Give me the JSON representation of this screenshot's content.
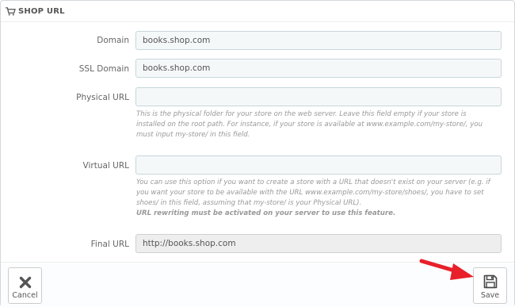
{
  "panel": {
    "title": "SHOP URL",
    "icon": "cart-icon"
  },
  "form": {
    "domain": {
      "label": "Domain",
      "value": "books.shop.com"
    },
    "ssl_domain": {
      "label": "SSL Domain",
      "value": "books.shop.com"
    },
    "physical_url": {
      "label": "Physical URL",
      "value": "",
      "help_lines": [
        "This is the physical folder for your store on the web server. Leave this field empty if your store is",
        "installed on the root path. For instance, if your store is available at www.example.com/my-store/, you",
        "must input my-store/ in this field."
      ]
    },
    "virtual_url": {
      "label": "Virtual URL",
      "value": "",
      "help_lines": [
        "You can use this option if you want to create a store with a URL that doesn't exist on your server (e.g. if",
        "you want your store to be available with the URL www.example.com/my-store/shoes/, you have to set",
        "shoes/ in this field, assuming that my-store/ is your Physical URL)."
      ],
      "help_bold": "URL rewriting must be activated on your server to use this feature."
    },
    "final_url": {
      "label": "Final URL",
      "value": "http://books.shop.com"
    }
  },
  "footer": {
    "cancel_label": "Cancel",
    "save_label": "Save"
  },
  "colors": {
    "annotation_arrow": "#e8202a"
  }
}
